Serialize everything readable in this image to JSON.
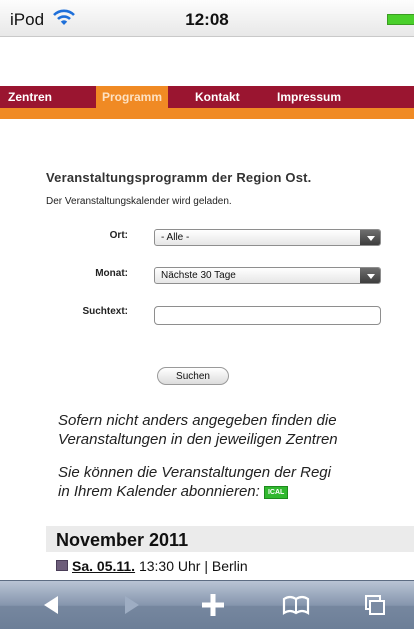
{
  "status_bar": {
    "carrier": "iPod",
    "time": "12:08",
    "wifi_icon": "wifi-icon",
    "battery_icon": "battery-icon"
  },
  "nav": {
    "items": [
      {
        "label": "Zentren",
        "active": false
      },
      {
        "label": "Programm",
        "active": true
      },
      {
        "label": "Kontakt",
        "active": false
      },
      {
        "label": "Impressum",
        "active": false
      }
    ]
  },
  "colors": {
    "nav_background": "#9a1530",
    "accent_orange": "#f08a24",
    "ical_green": "#31b82f"
  },
  "main": {
    "heading": "Veranstaltungsprogramm der Region Ost.",
    "loading_text": "Der Veranstaltungskalender wird geladen."
  },
  "form": {
    "ort_label": "Ort:",
    "ort_value": "- Alle -",
    "monat_label": "Monat:",
    "monat_value": "Nächste 30 Tage",
    "suchtext_label": "Suchtext:",
    "suchtext_value": "",
    "search_button": "Suchen"
  },
  "info": {
    "line1": "Sofern nicht anders angegeben finden die",
    "line2": "Veranstaltungen in den jeweiligen Zentren",
    "line3": "Sie können die Veranstaltungen der Regi",
    "line4": "in Ihrem Kalender abonnieren:",
    "ical_badge": "ICAL"
  },
  "events": {
    "month": "November 2011",
    "first_event": {
      "date": "Sa. 05.11.",
      "details": " 13:30 Uhr | Berlin"
    }
  },
  "toolbar": {
    "buttons": [
      "back-arrow-icon",
      "forward-arrow-icon",
      "add-icon",
      "bookmarks-icon",
      "pages-icon"
    ]
  }
}
